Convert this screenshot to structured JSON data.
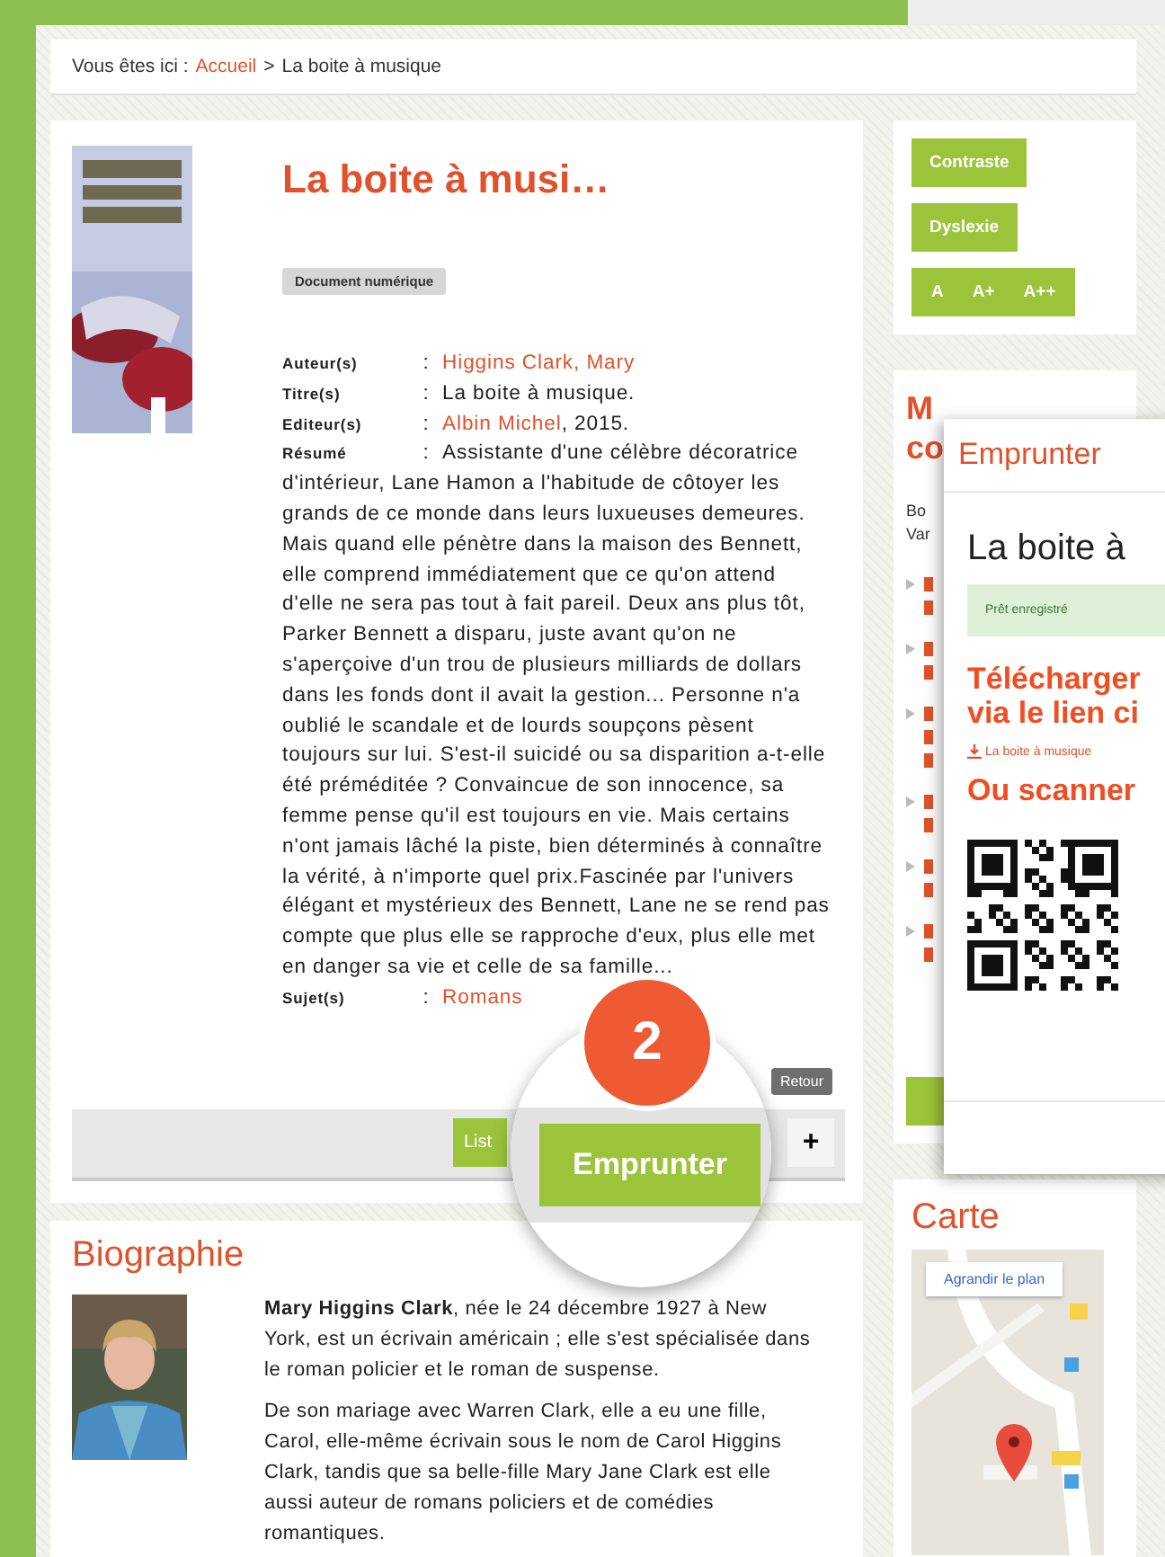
{
  "breadcrumb": {
    "prefix": "Vous êtes ici :",
    "link": "Accueil",
    "separator": ">",
    "current": "La boite à musique"
  },
  "record": {
    "title": "La boite à musi…",
    "badge": "Document numérique",
    "fields": [
      {
        "label": "Auteur(s)",
        "colon": ":",
        "kind": "field",
        "parts": [
          {
            "text": "Higgins Clark, Mary",
            "link": true
          }
        ]
      },
      {
        "label": "Titre(s)",
        "colon": ":",
        "kind": "field",
        "parts": [
          {
            "text": "La boite à musique.",
            "link": false
          }
        ]
      },
      {
        "label": "Editeur(s)",
        "colon": ":",
        "kind": "field",
        "parts": [
          {
            "text": "Albin Michel",
            "link": true
          },
          {
            "text": ", 2015.",
            "link": false
          }
        ]
      },
      {
        "label": "Résumé",
        "colon": ":",
        "kind": "paragraph",
        "text": "Assistante d'une célèbre décoratrice d'intérieur, Lane Hamon a l'habitude de côtoyer les grands de ce monde dans leurs luxueuses demeures. Mais quand elle pénètre dans la maison des Bennett, elle comprend immédiatement que ce qu'on attend d'elle ne sera pas tout à fait pareil. Deux ans plus tôt, Parker Bennett a disparu, juste avant qu'on ne s'aperçoive d'un trou de plusieurs milliards de dollars dans les fonds dont il avait la gestion... Personne n'a oublié le scandale et de lourds soupçons pèsent toujours sur lui. S'est-il suicidé ou sa disparition a-t-elle été préméditée ? Convaincue de son innocence, sa femme pense qu'il est toujours en vie. Mais certains n'ont jamais lâché la piste, bien déterminés à connaître la vérité, à n'importe quel prix.Fascinée par l'univers élégant et mystérieux des Bennett, Lane ne se rend pas compte que plus elle se rapproche d'eux, plus elle met en danger sa vie et celle de sa famille..."
      },
      {
        "label": "Sujet(s)",
        "colon": ":",
        "kind": "field",
        "parts": [
          {
            "text": "Romans",
            "link": true
          }
        ]
      }
    ],
    "back_button": "Retour",
    "list_button": "List",
    "plus_button": "+"
  },
  "biography": {
    "title": "Biographie",
    "paragraphs": [
      "**Mary Higgins Clark**, née le 24 décembre 1927 à New York, est un écrivain américain ; elle s'est spécialisée dans le roman policier et le roman de suspense.",
      "De son mariage avec Warren Clark, elle a eu une fille, Carol, elle-même écrivain sous le nom de Carol Higgins Clark, tandis que sa belle-fille Mary Jane Clark est elle aussi auteur de romans policiers et de comédies romantiques."
    ]
  },
  "sidebar": {
    "accessibility": {
      "buttons": [
        "Contraste",
        "Dyslexie"
      ],
      "font_sizes": [
        "A",
        "A+",
        "A++"
      ]
    },
    "partial_widget": {
      "title_lines": [
        "M",
        "co"
      ],
      "text_lines": [
        "Bo",
        "Var"
      ],
      "bullet_items": [
        {
          "kind": "link"
        },
        {
          "kind": "link"
        },
        {
          "kind": "link"
        },
        {
          "kind": "link"
        },
        {
          "kind": "link"
        },
        {
          "kind": "link"
        }
      ]
    },
    "map": {
      "title": "Carte",
      "enlarge": "Agrandir le plan"
    }
  },
  "modal": {
    "header": "Emprunter",
    "title": "La boite à",
    "alert": "Prêt enregistré",
    "download_heading": [
      "Télécharger",
      "via le lien ci"
    ],
    "download_link": "La boite à musique",
    "scan_heading": "Ou scanner"
  },
  "callout": {
    "step": "2",
    "button": "Emprunter"
  }
}
